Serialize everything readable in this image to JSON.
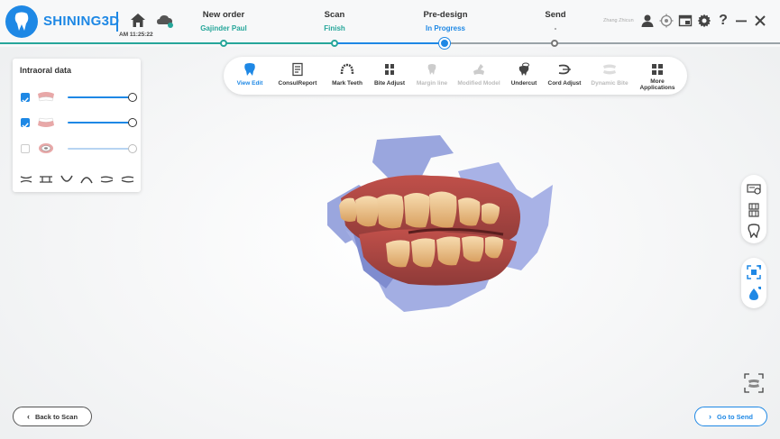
{
  "app": {
    "brand": "SHINING3D",
    "clock": "AM 11:25:22",
    "user": "Zhang Zhicun"
  },
  "steps": [
    {
      "title": "New order",
      "status": "Gajinder Paul"
    },
    {
      "title": "Scan",
      "status": "Finish"
    },
    {
      "title": "Pre-design",
      "status": "In Progress"
    },
    {
      "title": "Send",
      "status": "-"
    }
  ],
  "panel": {
    "title": "Intraoral data",
    "layers": [
      {
        "checked": true,
        "opacity": 1.0
      },
      {
        "checked": true,
        "opacity": 1.0
      },
      {
        "checked": false,
        "opacity": 1.0
      }
    ]
  },
  "toolbar": [
    {
      "label": "View Edit",
      "state": "active"
    },
    {
      "label": "ConsulReport",
      "state": "normal"
    },
    {
      "label": "Mark Teeth",
      "state": "normal"
    },
    {
      "label": "Bite Adjust",
      "state": "normal"
    },
    {
      "label": "Margin line",
      "state": "disabled"
    },
    {
      "label": "Modified Model",
      "state": "disabled"
    },
    {
      "label": "Undercut",
      "state": "normal"
    },
    {
      "label": "Cord Adjust",
      "state": "normal"
    },
    {
      "label": "Dynamic Bite",
      "state": "disabled"
    },
    {
      "label": "More Applications",
      "state": "normal"
    }
  ],
  "buttons": {
    "back": "Back to Scan",
    "send": "Go to Send"
  },
  "colors": {
    "accent": "#1e88e5",
    "teal": "#26a69a"
  }
}
